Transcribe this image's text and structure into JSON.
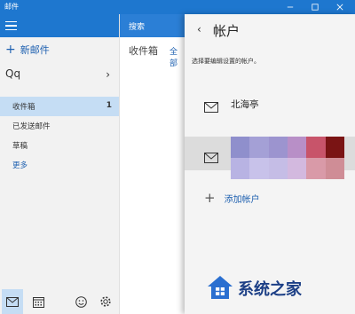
{
  "window": {
    "title": "邮件"
  },
  "nav": {
    "new_mail": "新邮件",
    "account_name": "Qq",
    "folders": [
      {
        "label": "收件箱",
        "count": "1"
      },
      {
        "label": "已发送邮件"
      },
      {
        "label": "草稿"
      },
      {
        "label": "更多"
      }
    ]
  },
  "list": {
    "search_label": "搜索",
    "folder_label": "收件箱",
    "filter_label": "全部"
  },
  "panel": {
    "title": "帐户",
    "subtitle": "选择要编辑设置的帐户。",
    "accounts": [
      {
        "name": "北海亭"
      }
    ],
    "add_account": "添加帐户"
  },
  "watermark": {
    "text": "系统之家"
  },
  "colors": {
    "accent": "#1e77cf",
    "selected": "#c5ddf4",
    "link": "#1e60b0",
    "blur_cells": [
      "#8f8fcc",
      "#a4a0d6",
      "#9c94cf",
      "#b88fc7",
      "#c8546a",
      "#7a1414",
      "#b8b3e3",
      "#c8c2ea",
      "#c5bde6",
      "#d3b9df",
      "#d99aa8",
      "#cf8d96"
    ]
  }
}
